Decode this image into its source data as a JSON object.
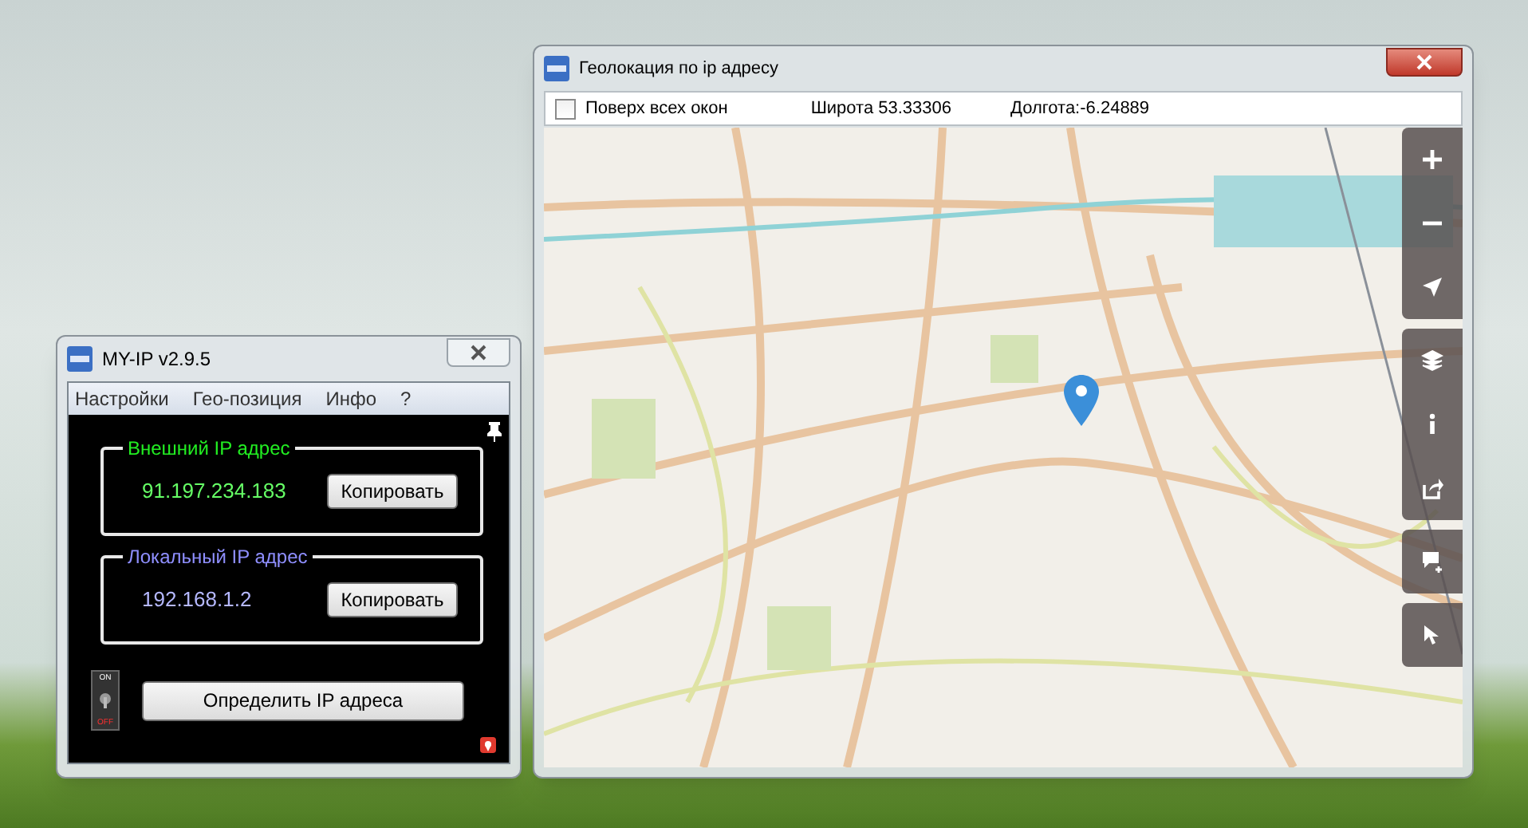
{
  "main_window": {
    "title": "MY-IP v2.9.5",
    "menu": [
      "Настройки",
      "Гео-позиция",
      "Инфо",
      "?"
    ],
    "groups": [
      {
        "kind": "external",
        "label": "Внешний IP адрес",
        "value": "91.197.234.183",
        "button": "Копировать"
      },
      {
        "kind": "local",
        "label": "Локальный IP адрес",
        "value": "192.168.1.2",
        "button": "Копировать"
      }
    ],
    "toggle": {
      "on_label": "ON",
      "off_label": "OFF",
      "on": false
    },
    "detect_button": "Определить IP адреса"
  },
  "map_window": {
    "title": "Геолокация по ip адресу",
    "stay_on_top": {
      "label": "Поверх всех окон",
      "checked": false
    },
    "latitude": "Широта 53.33306",
    "longitude": "Долгота:-6.24889",
    "control_groups": [
      {
        "controls": [
          {
            "kind": "zoom-in"
          },
          {
            "kind": "zoom-out"
          },
          {
            "kind": "locate"
          }
        ]
      },
      {
        "controls": [
          {
            "kind": "layers"
          },
          {
            "kind": "info"
          },
          {
            "kind": "share"
          }
        ]
      },
      {
        "controls": [
          {
            "kind": "note"
          }
        ]
      },
      {
        "controls": [
          {
            "kind": "query"
          }
        ]
      }
    ]
  }
}
